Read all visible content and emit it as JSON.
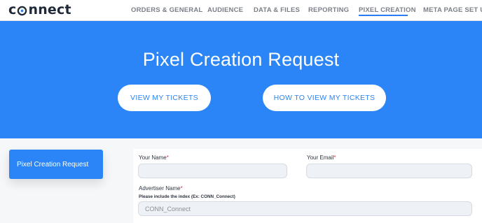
{
  "brand": {
    "logo_pre": "c",
    "logo_post": "nnect"
  },
  "nav": {
    "items": [
      {
        "label": "ORDERS & GENERAL"
      },
      {
        "label": "AUDIENCE"
      },
      {
        "label": "DATA & FILES"
      },
      {
        "label": "REPORTING"
      },
      {
        "label": "PIXEL CREATION"
      },
      {
        "label": "META PAGE SET UP"
      }
    ],
    "active_index": 4
  },
  "hero": {
    "title": "Pixel Creation Request",
    "buttons": [
      {
        "label": "VIEW MY TICKETS"
      },
      {
        "label": "HOW TO VIEW MY TICKETS"
      }
    ]
  },
  "sidebar": {
    "active_item": "Pixel Creation Request"
  },
  "form": {
    "your_name_label": "Your Name",
    "your_email_label": "Your Email",
    "advertiser_label": "Advertiser Name",
    "required_mark": "*",
    "advertiser_hint": "Please include the index (Ex: CONN_Connect)",
    "advertiser_placeholder": "CONN_Connect",
    "your_name_value": "",
    "your_email_value": ""
  },
  "colors": {
    "accent": "#2b85f6",
    "required": "#e0303a",
    "field_bg": "#eef2f6"
  }
}
